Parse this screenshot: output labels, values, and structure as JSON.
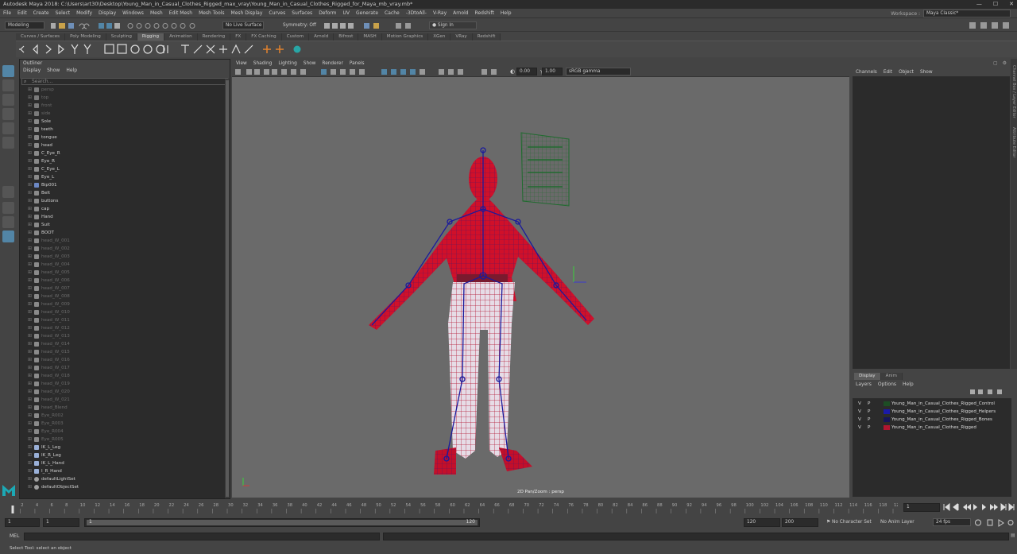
{
  "titlebar": {
    "title": "Autodesk Maya 2018: C:\\Users\\art30\\Desktop\\Young_Man_in_Casual_Clothes_Rigged_max_vray\\Young_Man_in_Casual_Clothes_Rigged_for_Maya_mb_vray.mb*",
    "minimize": "—",
    "maximize": "☐",
    "close": "✕"
  },
  "menubar": {
    "items": [
      "File",
      "Edit",
      "Create",
      "Select",
      "Modify",
      "Display",
      "Windows",
      "Mesh",
      "Edit Mesh",
      "Mesh Tools",
      "Mesh Display",
      "Curves",
      "Surfaces",
      "Deform",
      "UV",
      "Generate",
      "Cache",
      "-3DtoAll-",
      "V-Ray",
      "Arnold",
      "Redshift",
      "Help"
    ],
    "workspace_label": "Workspace :",
    "workspace_value": "Maya Classic*"
  },
  "statusline": {
    "mode": "Modeling",
    "live_surface": "No Live Surface",
    "symmetry": "Symmetry: Off",
    "sign_in": "Sign In"
  },
  "shelf": {
    "tabs": [
      "Curves / Surfaces",
      "Poly Modeling",
      "Sculpting",
      "Rigging",
      "Animation",
      "Rendering",
      "FX",
      "FX Caching",
      "Custom",
      "Arnold",
      "Bifrost",
      "MASH",
      "Motion Graphics",
      "XGen",
      "VRay",
      "Redshift"
    ],
    "active_tab": 3
  },
  "outliner": {
    "title": "Outliner",
    "menu": [
      "Display",
      "Show",
      "Help"
    ],
    "search_placeholder": "Search...",
    "items": [
      {
        "label": "persp",
        "kind": "camera",
        "dim": true
      },
      {
        "label": "top",
        "kind": "camera",
        "dim": true
      },
      {
        "label": "front",
        "kind": "camera",
        "dim": true
      },
      {
        "label": "side",
        "kind": "camera",
        "dim": true
      },
      {
        "label": "Sole",
        "kind": "mesh",
        "dim": false
      },
      {
        "label": "teeth",
        "kind": "mesh",
        "dim": false
      },
      {
        "label": "tongue",
        "kind": "mesh",
        "dim": false
      },
      {
        "label": "head",
        "kind": "mesh",
        "dim": false
      },
      {
        "label": "C_Eye_R",
        "kind": "mesh",
        "dim": false
      },
      {
        "label": "Eye_R",
        "kind": "mesh",
        "dim": false
      },
      {
        "label": "C_Eye_L",
        "kind": "mesh",
        "dim": false
      },
      {
        "label": "Eye_L",
        "kind": "mesh",
        "dim": false
      },
      {
        "label": "Bip001",
        "kind": "joint",
        "dim": false
      },
      {
        "label": "Belt",
        "kind": "mesh",
        "dim": false
      },
      {
        "label": "buttons",
        "kind": "mesh",
        "dim": false
      },
      {
        "label": "cap",
        "kind": "mesh",
        "dim": false
      },
      {
        "label": "Hand",
        "kind": "mesh",
        "dim": false
      },
      {
        "label": "Suit",
        "kind": "mesh",
        "dim": false
      },
      {
        "label": "BOOT",
        "kind": "mesh",
        "dim": false
      },
      {
        "label": "head_W_001",
        "kind": "mesh",
        "dim": true
      },
      {
        "label": "head_W_002",
        "kind": "mesh",
        "dim": true
      },
      {
        "label": "head_W_003",
        "kind": "mesh",
        "dim": true
      },
      {
        "label": "head_W_004",
        "kind": "mesh",
        "dim": true
      },
      {
        "label": "head_W_005",
        "kind": "mesh",
        "dim": true
      },
      {
        "label": "head_W_006",
        "kind": "mesh",
        "dim": true
      },
      {
        "label": "head_W_007",
        "kind": "mesh",
        "dim": true
      },
      {
        "label": "head_W_008",
        "kind": "mesh",
        "dim": true
      },
      {
        "label": "head_W_009",
        "kind": "mesh",
        "dim": true
      },
      {
        "label": "head_W_010",
        "kind": "mesh",
        "dim": true
      },
      {
        "label": "head_W_011",
        "kind": "mesh",
        "dim": true
      },
      {
        "label": "head_W_012",
        "kind": "mesh",
        "dim": true
      },
      {
        "label": "head_W_013",
        "kind": "mesh",
        "dim": true
      },
      {
        "label": "head_W_014",
        "kind": "mesh",
        "dim": true
      },
      {
        "label": "head_W_015",
        "kind": "mesh",
        "dim": true
      },
      {
        "label": "head_W_016",
        "kind": "mesh",
        "dim": true
      },
      {
        "label": "head_W_017",
        "kind": "mesh",
        "dim": true
      },
      {
        "label": "head_W_018",
        "kind": "mesh",
        "dim": true
      },
      {
        "label": "head_W_019",
        "kind": "mesh",
        "dim": true
      },
      {
        "label": "head_W_020",
        "kind": "mesh",
        "dim": true
      },
      {
        "label": "head_W_021",
        "kind": "mesh",
        "dim": true
      },
      {
        "label": "head_Blend",
        "kind": "mesh",
        "dim": true
      },
      {
        "label": "Eye_R002",
        "kind": "mesh",
        "dim": true
      },
      {
        "label": "Eye_R003",
        "kind": "mesh",
        "dim": true
      },
      {
        "label": "Eye_R004",
        "kind": "mesh",
        "dim": true
      },
      {
        "label": "Eye_R005",
        "kind": "mesh",
        "dim": true
      },
      {
        "label": "IK_L_Leg",
        "kind": "ik",
        "dim": false
      },
      {
        "label": "IK_R_Leg",
        "kind": "ik",
        "dim": false
      },
      {
        "label": "IK_L_Hand",
        "kind": "ik",
        "dim": false
      },
      {
        "label": "I_R_Hand",
        "kind": "ik",
        "dim": false
      },
      {
        "label": "defaultLightSet",
        "kind": "set",
        "dim": false
      },
      {
        "label": "defaultObjectSet",
        "kind": "set",
        "dim": false
      }
    ]
  },
  "viewport": {
    "menu": [
      "View",
      "Shading",
      "Lighting",
      "Show",
      "Renderer",
      "Panels"
    ],
    "exposure": "0.00",
    "gamma": "1.00",
    "color_space": "sRGB gamma",
    "label": "2D Pan/Zoom : persp"
  },
  "channelbox": {
    "menu": [
      "Channels",
      "Edit",
      "Object",
      "Show"
    ],
    "side_tabs": [
      "Channel Box / Layer Editor",
      "Attribute Editor"
    ]
  },
  "layers": {
    "tabs": [
      "Display",
      "Anim"
    ],
    "menu": [
      "Layers",
      "Options",
      "Help"
    ],
    "rows": [
      {
        "v": "V",
        "p": "P",
        "name": "Young_Man_in_Casual_Clothes_Rigged_Control",
        "color": "#1d4d24"
      },
      {
        "v": "V",
        "p": "P",
        "name": "Young_Man_in_Casual_Clothes_Rigged_Helpers",
        "color": "#1a1aa8"
      },
      {
        "v": "V",
        "p": "P",
        "name": "Young_Man_in_Casual_Clothes_Rigged_Bones",
        "color": "#15155a"
      },
      {
        "v": "V",
        "p": "P",
        "name": "Young_Man_in_Casual_Clothes_Rigged",
        "color": "#b01630"
      }
    ]
  },
  "timeline": {
    "ticks": [
      2,
      4,
      6,
      8,
      10,
      12,
      14,
      16,
      18,
      20,
      22,
      24,
      26,
      28,
      30,
      32,
      34,
      36,
      38,
      40,
      42,
      44,
      46,
      48,
      50,
      52,
      54,
      56,
      58,
      60,
      62,
      64,
      66,
      68,
      70,
      72,
      74,
      76,
      78,
      80,
      82,
      84,
      86,
      88,
      90,
      92,
      94,
      96,
      98,
      100,
      102,
      104,
      106,
      108,
      110,
      112,
      114,
      116,
      118,
      120
    ],
    "min": 1,
    "max": 120,
    "current_frame": "1"
  },
  "range": {
    "start": "1",
    "playback_start": "1",
    "slider_start": "1",
    "slider_end": "120",
    "playback_end": "120",
    "end": "200",
    "character_set": "No Character Set",
    "anim_layer": "No Anim Layer",
    "fps": "24 fps"
  },
  "mel": {
    "label": "MEL"
  },
  "help_line": "Select Tool: select an object",
  "colors": {
    "accent": "#5285a6",
    "mesh_red": "#d0102a",
    "wire_blue": "#1a1a9c",
    "control_green": "#1f6b2e"
  }
}
